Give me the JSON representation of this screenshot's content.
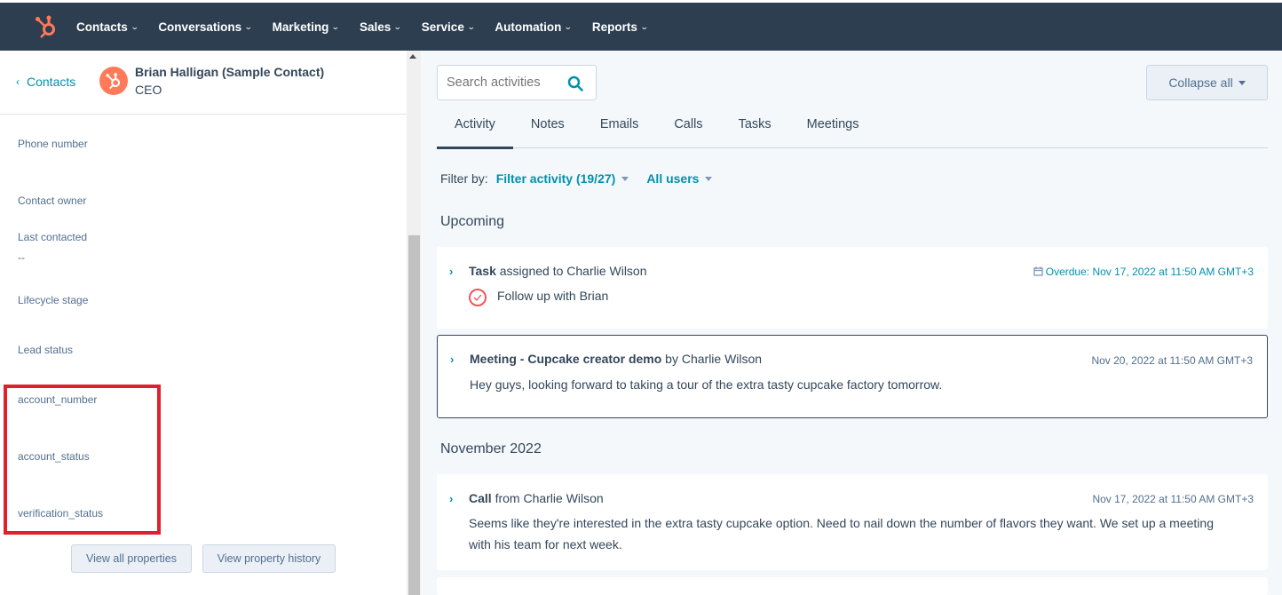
{
  "nav": {
    "items": [
      "Contacts",
      "Conversations",
      "Marketing",
      "Sales",
      "Service",
      "Automation",
      "Reports"
    ],
    "brand_color": "#ff7a59"
  },
  "contact": {
    "back_label": "Contacts",
    "name": "Brian Halligan (Sample Contact)",
    "title": "CEO"
  },
  "properties": {
    "phone_number": "Phone number",
    "contact_owner": "Contact owner",
    "last_contacted": "Last contacted",
    "last_contacted_value": "--",
    "lifecycle_stage": "Lifecycle stage",
    "lead_status": "Lead status",
    "account_number": "account_number",
    "account_status": "account_status",
    "verification_status": "verification_status"
  },
  "buttons": {
    "view_all": "View all properties",
    "view_history": "View property history",
    "collapse_all": "Collapse all"
  },
  "search": {
    "placeholder": "Search activities"
  },
  "tabs": [
    "Activity",
    "Notes",
    "Emails",
    "Calls",
    "Tasks",
    "Meetings"
  ],
  "filter": {
    "label": "Filter by:",
    "activity": "Filter activity (19/27)",
    "users": "All users"
  },
  "sections": {
    "upcoming": "Upcoming",
    "november": "November 2022"
  },
  "cards": {
    "task": {
      "type": "Task",
      "rest": " assigned to Charlie Wilson",
      "date": "Overdue: Nov 17, 2022 at 11:50 AM GMT+3",
      "body": "Follow up with Brian"
    },
    "meeting": {
      "type": "Meeting - Cupcake creator demo",
      "rest": " by Charlie Wilson",
      "date": "Nov 20, 2022 at 11:50 AM GMT+3",
      "body": "Hey guys, looking forward to taking a tour of the extra tasty cupcake factory tomorrow."
    },
    "call": {
      "type": "Call",
      "rest": " from Charlie Wilson",
      "date": "Nov 17, 2022 at 11:50 AM GMT+3",
      "body_line1": "Seems like they're interested in the extra tasty cupcake option. Need to nail down the number of flavors they want. We set up a meeting",
      "body_line2": "with his team for next week."
    }
  }
}
